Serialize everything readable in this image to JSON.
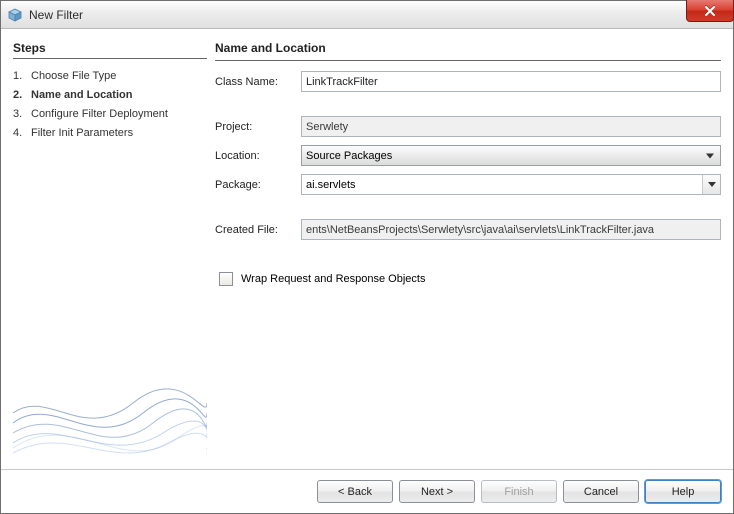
{
  "window": {
    "title": "New Filter"
  },
  "steps": {
    "heading": "Steps",
    "items": [
      {
        "num": "1.",
        "label": "Choose File Type"
      },
      {
        "num": "2.",
        "label": "Name and Location"
      },
      {
        "num": "3.",
        "label": "Configure Filter Deployment"
      },
      {
        "num": "4.",
        "label": "Filter Init Parameters"
      }
    ],
    "current_index": 1
  },
  "main": {
    "heading": "Name and Location",
    "className_label": "Class Name:",
    "className_value": "LinkTrackFilter",
    "project_label": "Project:",
    "project_value": "Serwlety",
    "location_label": "Location:",
    "location_value": "Source Packages",
    "package_label": "Package:",
    "package_value": "ai.servlets",
    "createdFile_label": "Created File:",
    "createdFile_value": "ents\\NetBeansProjects\\Serwlety\\src\\java\\ai\\servlets\\LinkTrackFilter.java",
    "wrap_label": "Wrap Request and Response Objects",
    "wrap_checked": false
  },
  "buttons": {
    "back": "< Back",
    "next": "Next >",
    "finish": "Finish",
    "cancel": "Cancel",
    "help": "Help"
  }
}
